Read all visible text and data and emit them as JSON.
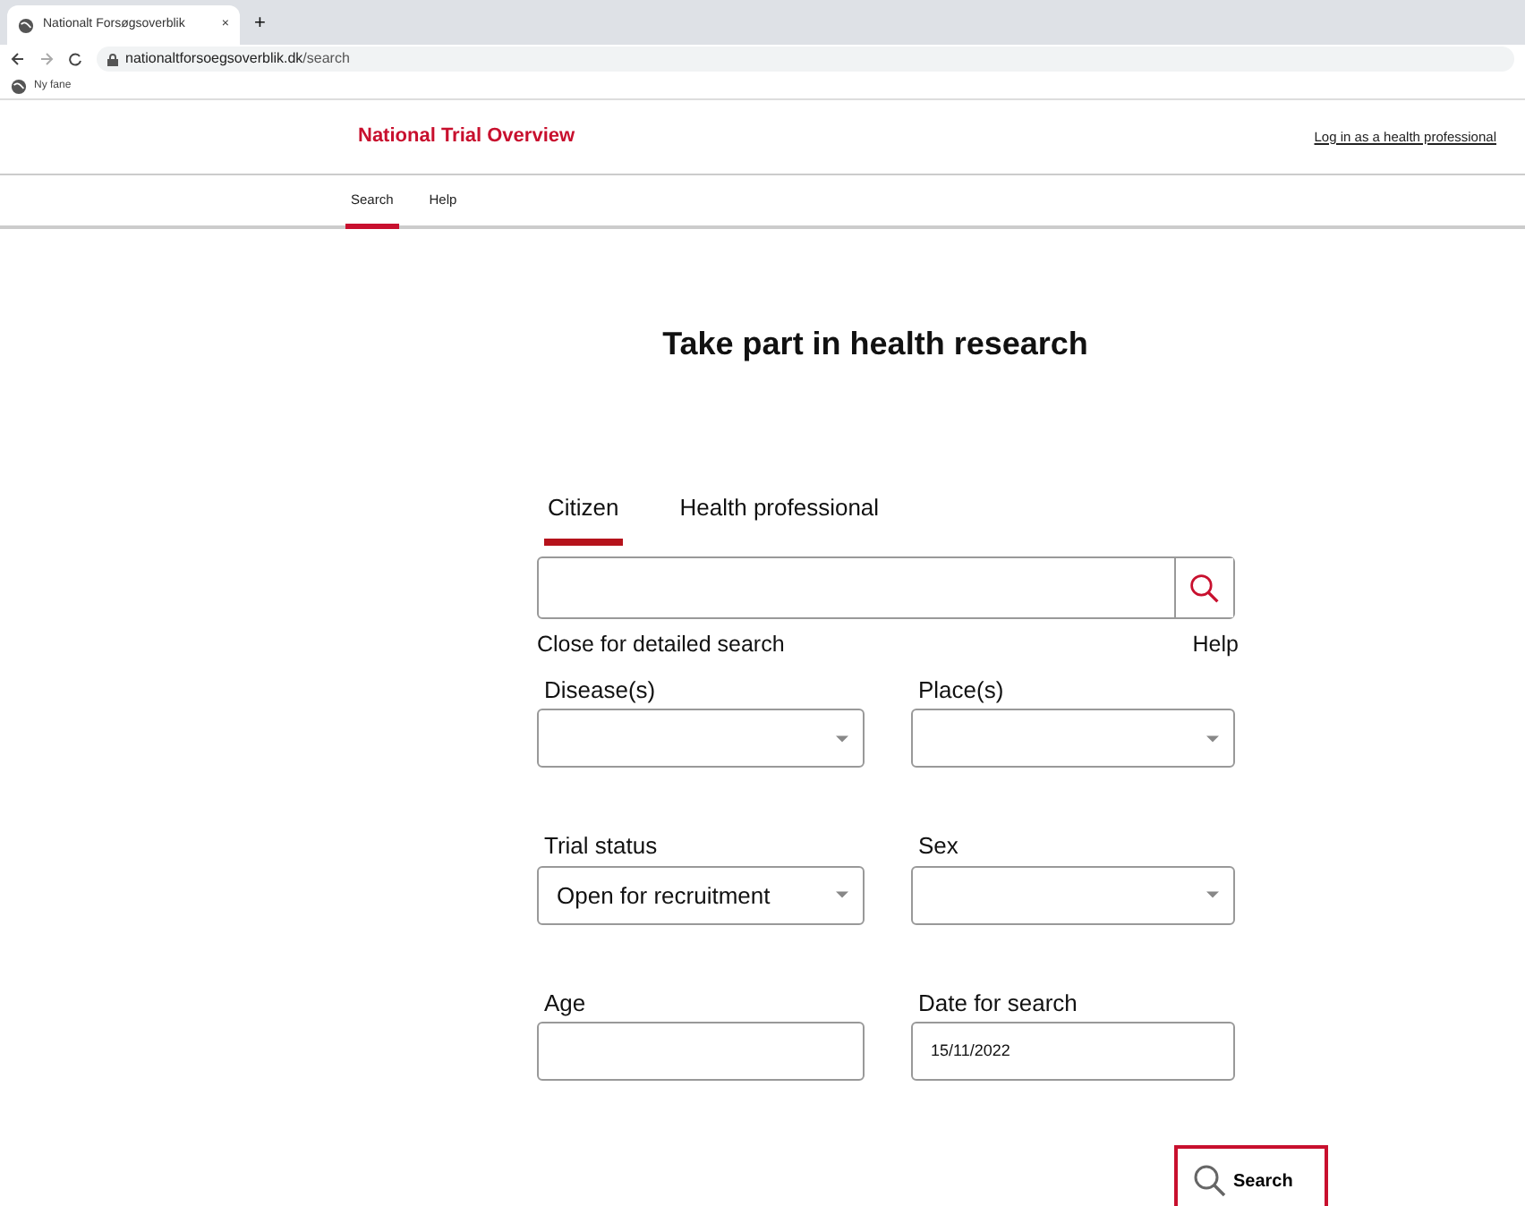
{
  "browser": {
    "tab_title": "Nationalt Forsøgsoverblik",
    "close_tab": "×",
    "new_tab": "+",
    "url_host": "nationaltforsoegsoverblik.dk",
    "url_path": "/search",
    "bookmark": "Ny fane"
  },
  "header": {
    "logo": "National Trial Overview",
    "login_link": "Log in as a health professional"
  },
  "nav": [
    {
      "label": "Search",
      "selected": true
    },
    {
      "label": "Help",
      "selected": false
    }
  ],
  "heading": "Take part in health research",
  "audience_tabs": [
    {
      "label": "Citizen",
      "selected": true
    },
    {
      "label": "Health professional",
      "selected": false
    }
  ],
  "detail_link": "Close for detailed search",
  "help_link": "Help",
  "filters": [
    {
      "kind": "select",
      "label": "Disease(s)"
    },
    {
      "kind": "select",
      "label": "Place(s)"
    },
    {
      "kind": "select",
      "label": "Trial status",
      "value": "Open for recruitment"
    },
    {
      "kind": "select",
      "label": "Sex"
    },
    {
      "kind": "input",
      "label": "Age"
    },
    {
      "kind": "input",
      "label": "Date for search",
      "value": "15/11/2022"
    }
  ],
  "search_button": "Search"
}
